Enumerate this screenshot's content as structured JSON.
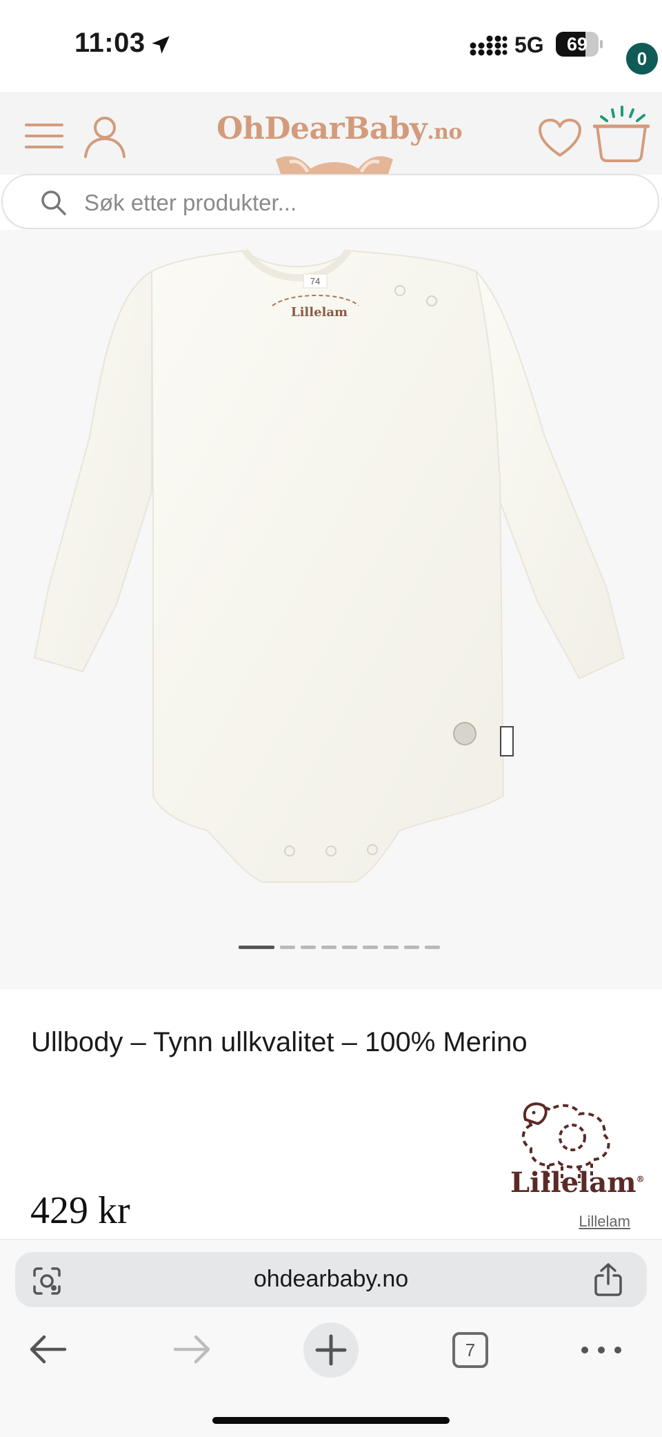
{
  "status_bar": {
    "time": "11:03",
    "network": "5G",
    "battery": "69",
    "battery_level": 0.69
  },
  "header": {
    "logo_main": "OhDearBaby",
    "logo_tld": ".no",
    "cart_count": "0",
    "accent_color": "#d39b7c",
    "badge_color": "#0f5b57",
    "icons": [
      "menu-icon",
      "user-icon",
      "heart-icon",
      "cart-icon"
    ]
  },
  "search": {
    "placeholder": "Søk etter produkter..."
  },
  "product": {
    "image_labels": {
      "size_tag": "74",
      "neck_brand": "Lillelam"
    },
    "carousel": {
      "total": 9,
      "active_index": 0
    },
    "title": "Ullbody – Tynn ullkvalitet – 100% Merino",
    "price": "429 kr",
    "brand": "Lillelam",
    "brand_link": "Lillelam",
    "brand_color": "#5b2a26"
  },
  "browser": {
    "url": "ohdearbaby.no",
    "tab_count": "7",
    "icons": [
      "lens-icon",
      "share-icon",
      "back-arrow-icon",
      "forward-arrow-icon",
      "plus-icon",
      "tabs-icon",
      "more-icon"
    ]
  }
}
